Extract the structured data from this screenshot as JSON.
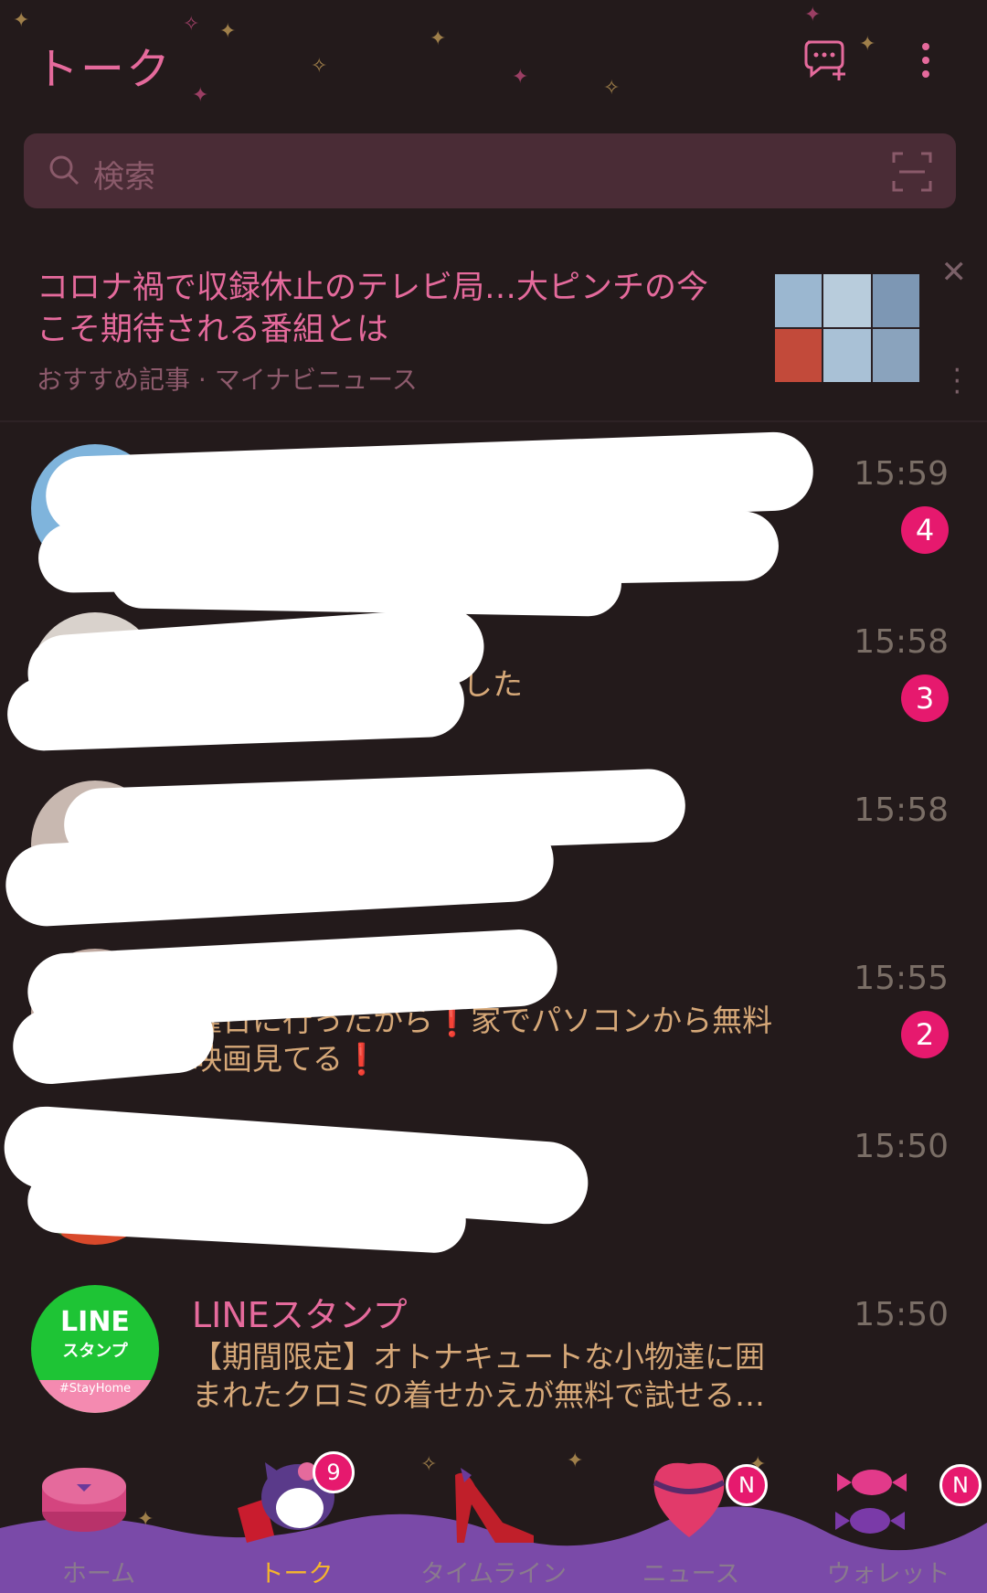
{
  "header": {
    "title": "トーク",
    "new_chat_icon": "chat-plus-icon",
    "menu_icon": "more-vertical-icon"
  },
  "search": {
    "placeholder": "検索",
    "icon": "search-icon",
    "scan_icon": "qr-scan-icon"
  },
  "news": {
    "headline": "コロナ禍で収録休止のテレビ局…大ピンチの今こそ期待される番組とは",
    "source": "おすすめ記事 · マイナビニュース"
  },
  "chats": [
    {
      "name": "",
      "message": "",
      "time": "15:59",
      "badge": "4"
    },
    {
      "name": "",
      "message": "スタンプを送信しました",
      "time": "15:58",
      "badge": "3"
    },
    {
      "name": "",
      "message": "",
      "time": "15:58",
      "badge": ""
    },
    {
      "name": "",
      "message": "曜日に行ったから❗家でパソコンから無料映画見てる❗",
      "time": "15:55",
      "badge": "2"
    },
    {
      "name": "",
      "message": "",
      "time": "15:50",
      "badge": ""
    },
    {
      "name": "LINEスタンプ",
      "message": "【期間限定】オトナキュートな小物達に囲まれたクロミの着せかえが無料で試せる…",
      "time": "15:50",
      "badge": ""
    }
  ],
  "line_avatar": {
    "top": "LINE",
    "sub": "スタンプ",
    "tag": "#StayHome"
  },
  "tabbar": {
    "tabs": [
      {
        "label": "ホーム",
        "badge": ""
      },
      {
        "label": "トーク",
        "badge": "9"
      },
      {
        "label": "タイムライン",
        "badge": ""
      },
      {
        "label": "ニュース",
        "badge": "N"
      },
      {
        "label": "ウォレット",
        "badge": "N"
      }
    ]
  },
  "colors": {
    "background": "#231a1b",
    "accent_pink": "#e56a9c",
    "badge": "#e6196e",
    "message_text": "#d6a878",
    "tabbar_wave": "#7a4aa8",
    "active_tab": "#f5b52c"
  }
}
